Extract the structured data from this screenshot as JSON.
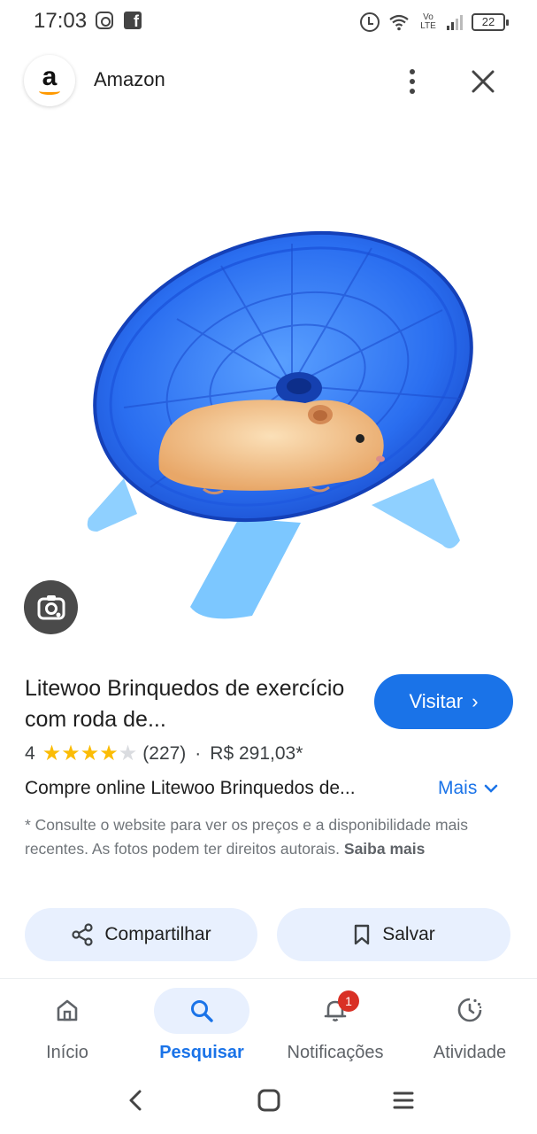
{
  "status_bar": {
    "time": "17:03",
    "volte": "Vo LTE",
    "battery": "22"
  },
  "header": {
    "logo_letter": "a",
    "site_name": "Amazon",
    "brand_color": "#ff9900"
  },
  "product": {
    "title": "Litewoo Brinquedos de exercício com roda de...",
    "image_icon": "hamster-wheel-image",
    "visit_label": "Visitar",
    "rating_value": "4",
    "rating_stars": 4,
    "review_count": "(227)",
    "separator": "·",
    "price": "R$ 291,03*",
    "description": "Compre online Litewoo Brinquedos de...",
    "more_label": "Mais",
    "disclaimer_text": "* Consulte o website para ver os preços e a disponibilidade mais recentes. As fotos podem ter direitos autorais.",
    "learn_more": "Saiba mais"
  },
  "actions": {
    "share_label": "Compartilhar",
    "save_label": "Salvar"
  },
  "bottom_nav": {
    "items": [
      {
        "label": "Início",
        "icon": "home-icon"
      },
      {
        "label": "Pesquisar",
        "icon": "search-icon",
        "active": true
      },
      {
        "label": "Notificações",
        "icon": "bell-icon",
        "badge": "1"
      },
      {
        "label": "Atividade",
        "icon": "activity-icon"
      }
    ]
  },
  "colors": {
    "accent": "#1a73e8",
    "button_bg": "#e8f0fe",
    "star": "#fbbc04",
    "badge": "#d93025"
  }
}
